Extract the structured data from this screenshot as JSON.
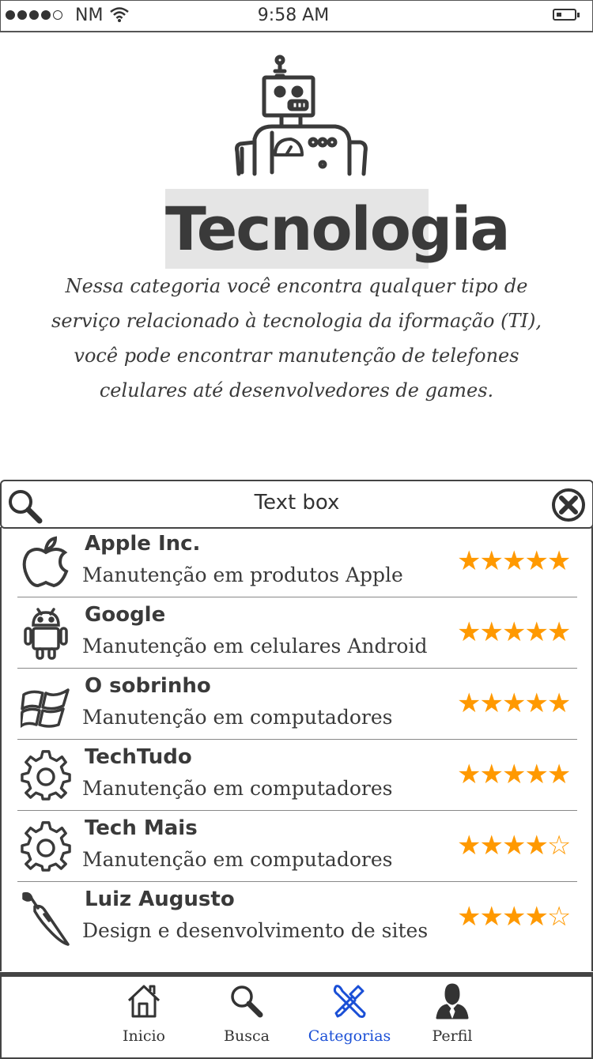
{
  "status_bar": {
    "carrier": "NM",
    "time": "9:58 AM",
    "signal_filled": 4,
    "signal_total": 5,
    "battery_level": 0.2
  },
  "header": {
    "image_icon": "robot-icon",
    "title": "Tecnologia",
    "description": "Nessa categoria você encontra qualquer tipo de serviço relacionado à tecnologia da iformação (TI), você pode encontrar manutenção de telefones celulares até desenvolvedores de games."
  },
  "search": {
    "placeholder": "Text box"
  },
  "list": {
    "items": [
      {
        "name": "Apple Inc.",
        "subtitle": "Manutenção em produtos Apple",
        "icon": "apple-icon",
        "rating": 5,
        "stars": "★★★★★"
      },
      {
        "name": "Google",
        "subtitle": "Manutenção em celulares Android",
        "icon": "android-icon",
        "rating": 5,
        "stars": "★★★★★"
      },
      {
        "name": "O sobrinho",
        "subtitle": "Manutenção em computadores",
        "icon": "windows-icon",
        "rating": 5,
        "stars": "★★★★★"
      },
      {
        "name": "TechTudo",
        "subtitle": "Manutenção em computadores",
        "icon": "gear-icon",
        "rating": 5,
        "stars": "★★★★★"
      },
      {
        "name": "Tech Mais",
        "subtitle": "Manutenção em computadores",
        "icon": "gear-icon",
        "rating": 4,
        "stars": "★★★★☆"
      },
      {
        "name": "Luiz Augusto",
        "subtitle": "Design e  desenvolvimento de sites",
        "icon": "paintbrush-icon",
        "rating": 4,
        "stars": "★★★★☆"
      }
    ]
  },
  "tabbar": {
    "tabs": [
      {
        "label": "Inicio",
        "icon": "home-icon",
        "active": false
      },
      {
        "label": "Busca",
        "icon": "search-icon",
        "active": false
      },
      {
        "label": "Categorias",
        "icon": "tools-icon",
        "active": true
      },
      {
        "label": "Perfil",
        "icon": "profile-icon",
        "active": false
      }
    ]
  },
  "colors": {
    "star": "#ff9900",
    "active_tab": "#1a4fd6",
    "text": "#3a3a3a",
    "title_highlight": "#e5e5e5"
  }
}
